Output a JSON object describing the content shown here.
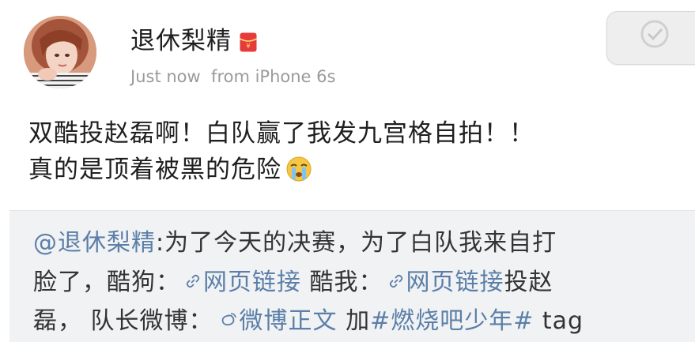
{
  "post": {
    "author": {
      "name": "退休梨精",
      "avatar_icon": "user-avatar-photo",
      "badge_icon": "red-envelope-badge-icon",
      "badge_color": "#e53b3b"
    },
    "meta": {
      "time": "Just now",
      "source": "from iPhone 6s"
    },
    "text": {
      "line1": "双酷投赵磊啊！白队赢了我发九宫格自拍！！",
      "line2": "真的是顶着被黑的危险",
      "emoji": "crying-face-emoji"
    }
  },
  "repost": {
    "mention": "@退休梨精",
    "text_a": ":为了今天的决赛，为了白队我来自打",
    "text_b": "脸了，酷狗：",
    "link1": "网页链接",
    "text_c": " 酷我：",
    "link2": "网页链接",
    "text_d": "投赵",
    "text_e": "磊，",
    "text_f": " 队长微博：",
    "weibo_link": "微博正文",
    "text_g": " 加",
    "topic": "#燃烧吧少年#",
    "text_h": " tag",
    "link_icon": "link-chain-icon",
    "weibo_icon": "weibo-icon",
    "link_color": "#5b7fa8"
  },
  "controls": {
    "corner_icon": "checkmark-icon"
  }
}
